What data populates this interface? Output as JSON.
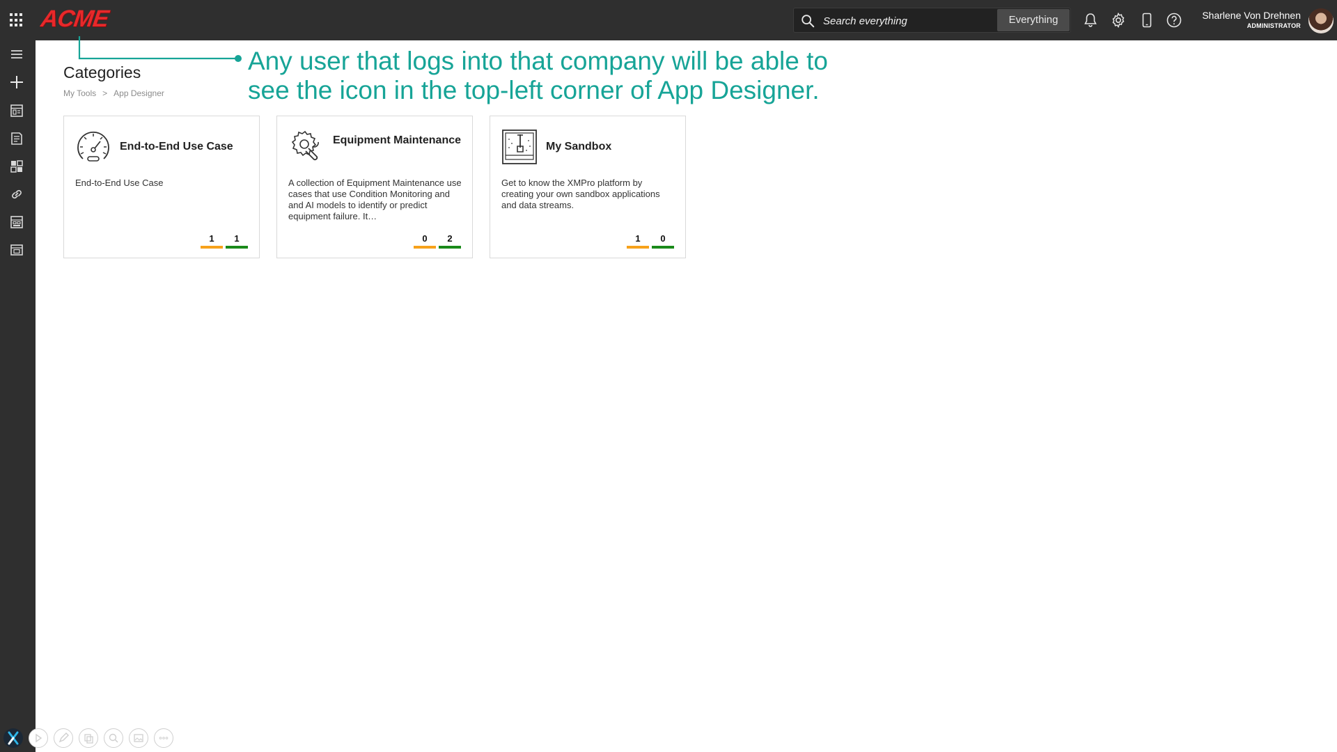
{
  "header": {
    "logo": "ACME",
    "search_placeholder": "Search everything",
    "search_scope": "Everything",
    "user_name": "Sharlene Von Drehnen",
    "user_role": "ADMINISTRATOR",
    "icons": [
      "apps-grid-icon",
      "bell-icon",
      "gear-icon",
      "mobile-icon",
      "help-icon"
    ]
  },
  "sidebar": {
    "items": [
      "menu-icon",
      "add-icon",
      "dashboard-icon",
      "document-icon",
      "widgets-icon",
      "link-icon",
      "grid-icon",
      "layout-icon"
    ]
  },
  "page": {
    "title": "Categories",
    "breadcrumb": [
      "My Tools",
      "App Designer"
    ]
  },
  "cards": [
    {
      "title": "End-to-End Use Case",
      "description": "End-to-End Use Case",
      "icon": "gauge-icon",
      "count_orange": "1",
      "count_green": "1"
    },
    {
      "title": "Equipment Maintenance",
      "description": "A collection of Equipment Maintenance use cases that use Condition Monitoring and and AI models to identify or predict equipment failure. It…",
      "icon": "gear-wrench-icon",
      "count_orange": "0",
      "count_green": "2"
    },
    {
      "title": "My Sandbox",
      "description": "Get to know the XMPro platform by creating your own sandbox applications and data streams.",
      "icon": "sandbox-icon",
      "count_orange": "1",
      "count_green": "0"
    }
  ],
  "annotation": {
    "line1": "Any user that logs into that company will be able to",
    "line2": "see the icon in the top-left corner of App Designer."
  },
  "colors": {
    "topbar": "#2f2f2f",
    "logo": "#e8282a",
    "annotation": "#17a497",
    "count_orange": "#f7a21b",
    "count_green": "#1a8a1a"
  }
}
